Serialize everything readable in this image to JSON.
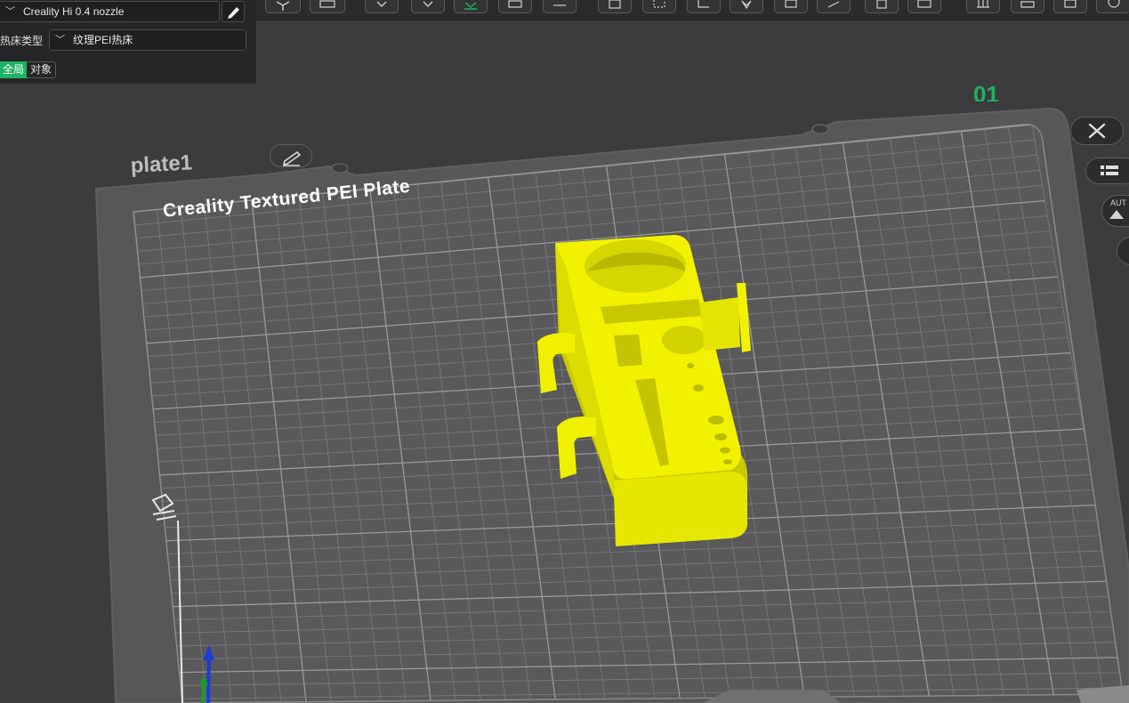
{
  "printer": {
    "nozzle_value": "Creality Hi 0.4 nozzle"
  },
  "bed": {
    "label": "热床类型",
    "value": "纹理PEI热床"
  },
  "tabs": {
    "global": "全局",
    "object": "对象"
  },
  "plate": {
    "name": "plate1",
    "title": "Creality Textured PEI Plate",
    "number": "01"
  },
  "right_buttons": {
    "auto_label": "AUT"
  },
  "colors": {
    "accent": "#1fb464",
    "model": "#f2f200",
    "bed": "#575759",
    "background": "#3c3c3e"
  },
  "icons": {
    "edit": "pencil-icon",
    "close": "close-icon",
    "list": "list-icon",
    "arrange": "auto-arrange-icon",
    "axis": "axis-gizmo-icon",
    "bed_origin": "bed-origin-icon"
  }
}
